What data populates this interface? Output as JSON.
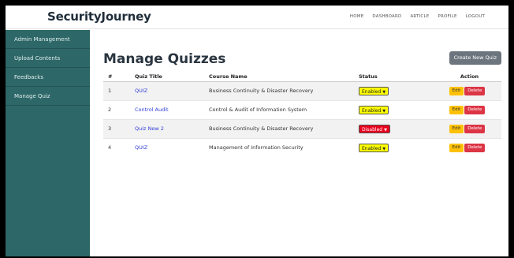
{
  "app": {
    "brand": "SecurityJourney"
  },
  "nav": {
    "home": "HOME",
    "dashboard": "DASHBOARD",
    "article": "ARTICLE",
    "profile": "PROFILE",
    "logout": "LOGOUT"
  },
  "sidebar": {
    "items": [
      {
        "label": "Admin Management"
      },
      {
        "label": "Upload Contents"
      },
      {
        "label": "Feedbacks"
      },
      {
        "label": "Manage Quiz"
      }
    ]
  },
  "main": {
    "title": "Manage Quizzes",
    "create_label": "Create New Quiz"
  },
  "table": {
    "headers": {
      "num": "#",
      "title": "Quiz Title",
      "course": "Course Name",
      "status": "Status",
      "action": "Action"
    },
    "rows": [
      {
        "num": "1",
        "title": "QUIZ",
        "course": "Business Continuity & Disaster Recovery",
        "status": "Enabled",
        "edit": "Edit",
        "delete": "Delete"
      },
      {
        "num": "2",
        "title": "Control Audit",
        "course": "Control & Audit of Information System",
        "status": "Enabled",
        "edit": "Edit",
        "delete": "Delete"
      },
      {
        "num": "3",
        "title": "Quiz New 2",
        "course": "Business Continuity & Disaster Recovery",
        "status": "Disabled",
        "edit": "Edit",
        "delete": "Delete"
      },
      {
        "num": "4",
        "title": "QUIZ",
        "course": "Management of Information Security",
        "status": "Enabled",
        "edit": "Edit",
        "delete": "Delete"
      }
    ]
  },
  "colors": {
    "sidebar": "#2e6767",
    "enabled": "#ffff00",
    "disabled": "#e8001c",
    "edit": "#ffc107",
    "delete": "#dc3545",
    "link": "#3340d9"
  },
  "icons": {
    "status_caret": "chevron-down-icon"
  }
}
